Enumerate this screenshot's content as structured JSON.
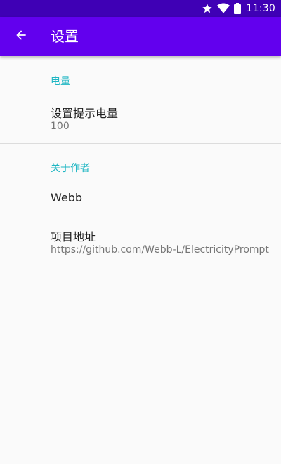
{
  "status_bar": {
    "time": "11:30",
    "icons": [
      "star-icon",
      "wifi-icon",
      "battery-icon"
    ]
  },
  "app_bar": {
    "back_icon": "arrow-back-icon",
    "title": "设置"
  },
  "categories": [
    {
      "title": "电量",
      "items": [
        {
          "title": "设置提示电量",
          "summary": "100"
        }
      ]
    },
    {
      "title": "关于作者",
      "items": [
        {
          "title": "Webb",
          "summary": ""
        },
        {
          "title": "项目地址",
          "summary": "https://github.com/Webb-L/ElectricityPrompt"
        }
      ]
    }
  ],
  "colors": {
    "status_bar": "#3f00b5",
    "app_bar": "#6200ee",
    "accent": "#1fb6c3",
    "background": "#fafafa"
  }
}
